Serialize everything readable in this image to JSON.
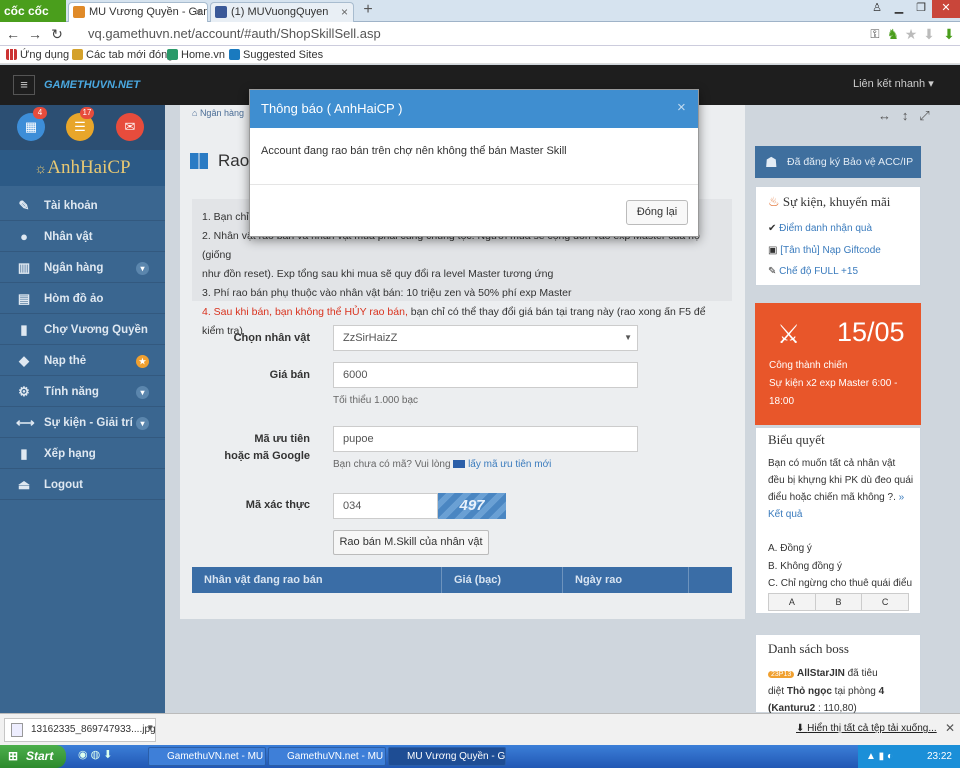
{
  "browser": {
    "brand": "cốc cốc",
    "tabs": [
      {
        "label": "MU Vương Quyền - Game"
      },
      {
        "label": "(1) MUVuongQuyen"
      }
    ],
    "url": "vq.gamethuvn.net/account/#auth/ShopSkillSell.asp",
    "bookmarks": [
      "Ứng dụng",
      "Các tab mới đóng",
      "Home.vn",
      "Suggested Sites"
    ]
  },
  "site": {
    "logo": "GAMETHUVN.NET",
    "quick_links": "Liên kết nhanh ▾"
  },
  "sidebar": {
    "badges": [
      "4",
      "17"
    ],
    "username": "AnhHaiCP",
    "items": [
      {
        "label": "Tài khoản",
        "icon": "✎"
      },
      {
        "label": "Nhân vật",
        "icon": "●"
      },
      {
        "label": "Ngân hàng",
        "icon": "▥",
        "arrow": true
      },
      {
        "label": "Hòm đồ ảo",
        "icon": "▤"
      },
      {
        "label": "Chợ Vương Quyền",
        "icon": "▮"
      },
      {
        "label": "Nạp thẻ",
        "icon": "◆",
        "star": true
      },
      {
        "label": "Tính năng",
        "icon": "⚙",
        "arrow": true
      },
      {
        "label": "Sự kiện - Giải trí",
        "icon": "⟷",
        "arrow": true
      },
      {
        "label": "Xếp hạng",
        "icon": "▮"
      },
      {
        "label": "Logout",
        "icon": "⏏"
      }
    ]
  },
  "main": {
    "breadcrumb": "Ngân hàng",
    "title": "Rao",
    "notes": [
      "1. Bạn chỉ c",
      "2. Nhân vật rao bán và nhân vật mua phải cùng chủng tộc. Người mua sẽ cộng đồn vào exp Master của họ (giống",
      "như đồn reset). Exp tổng sau khi mua sẽ quy đổi ra level Master tương ứng",
      "3. Phí rao bán phụ thuộc vào nhân vật bán: 10 triệu zen và 50% phí exp Master"
    ],
    "note_red": "4. Sau khi bán, bạn không thể HỦY rao bán,",
    "note_red_tail": " bạn chỉ có thể thay đổi giá bán tại trang này (rao xong ấn F5 để kiểm tra)",
    "form": {
      "char_label": "Chọn nhân vật",
      "char_value": "ZzSirHaizZ",
      "price_label": "Giá bán",
      "price_value": "6000",
      "price_hint": "Tối thiểu 1.000 bạc",
      "code_label_1": "Mã ưu tiên",
      "code_label_2": "hoặc mã Google",
      "code_value": "pupoe",
      "code_hint": "Bạn chưa có mã? Vui lòng",
      "code_link": "lấy mã ưu tiên mới",
      "captcha_label": "Mã xác thực",
      "captcha_value": "034",
      "captcha_image": "497",
      "submit": "Rao bán M.Skill của nhân vật"
    },
    "table_headers": [
      "Nhân vật đang rao bán",
      "Giá (bạc)",
      "Ngày rao"
    ]
  },
  "right": {
    "protect": "Đã đăng ký Bảo vệ ACC/IP",
    "events_title": "Sự kiện, khuyến mãi",
    "events": [
      "Điểm danh nhận quà",
      "[Tân thủ] Nạp Giftcode",
      "Chế độ FULL +15"
    ],
    "event_date": "15/05",
    "event_name": "Công thành chiến",
    "event_desc": "Sự kiện x2 exp Master 6:00 - 18:00",
    "poll_title": "Biểu quyết",
    "poll_q": "Bạn có muốn tất cả nhân vật đều bị khựng khi PK dù đeo quái điểu hoặc chiến mã không ?.",
    "poll_link": "» Kết quả",
    "poll_options": [
      "A. Đồng ý",
      "B. Không đồng ý",
      "C. Chỉ ngừng cho thuê quái điểu"
    ],
    "poll_buttons": [
      "A",
      "B",
      "C"
    ],
    "boss_title": "Danh sách boss",
    "boss_badge": "23P13",
    "boss_player": "AllStarJIN",
    "boss_text1": " đã tiêu",
    "boss_text2": "diệt ",
    "boss_name": "Thỏ ngọc",
    "boss_text3": " tại phòng ",
    "boss_room": "4",
    "boss_map": "(Kanturu2",
    "boss_coords": " : 110,80)"
  },
  "modal": {
    "title": "Thông báo ( AnhHaiCP )",
    "message": "Account đang rao bán trên chợ nên không thể bán Master Skill",
    "close_btn": "Đóng lại",
    "close_x": "×"
  },
  "downloads": {
    "file": "13162335_869747933....jpg",
    "show_all": "Hiển thị tất cả tệp tải xuống..."
  },
  "taskbar": {
    "start": "Start",
    "items": [
      "GamethuVN.net - MU ...",
      "GamethuVN.net - MU ...",
      "MU Vương Quyền - Ga..."
    ],
    "clock": "23:22"
  }
}
